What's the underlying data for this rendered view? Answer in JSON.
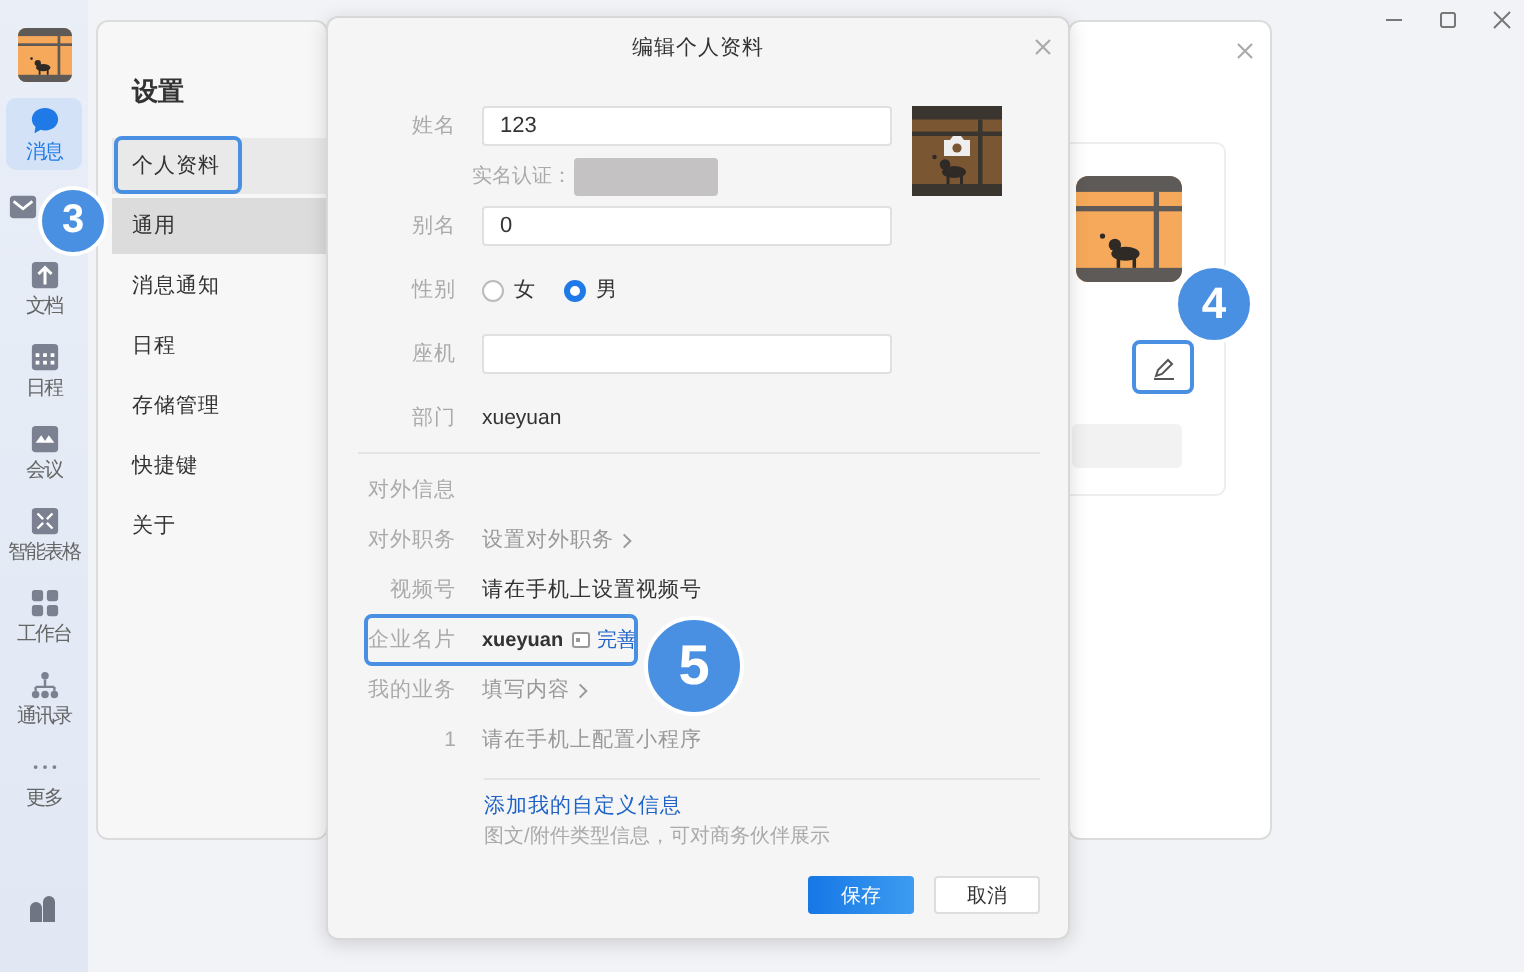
{
  "nav": {
    "items": [
      {
        "label": "消息",
        "selected": true
      },
      {
        "selected": false
      },
      {
        "label": "文档",
        "selected": false
      },
      {
        "label": "日程",
        "selected": false
      },
      {
        "label": "会议",
        "selected": false
      },
      {
        "label": "智能表格",
        "selected": false
      },
      {
        "label": "工作台",
        "selected": false
      },
      {
        "label": "通讯录",
        "selected": false
      },
      {
        "label": "更多",
        "selected": false
      }
    ]
  },
  "settings": {
    "title": "设置",
    "menu": [
      {
        "label": "个人资料",
        "selected": true,
        "hovered": false
      },
      {
        "label": "通用",
        "selected": false,
        "hovered": true
      },
      {
        "label": "消息通知",
        "selected": false,
        "hovered": false
      },
      {
        "label": "日程",
        "selected": false,
        "hovered": false
      },
      {
        "label": "存储管理",
        "selected": false,
        "hovered": false
      },
      {
        "label": "快捷键",
        "selected": false,
        "hovered": false
      },
      {
        "label": "关于",
        "selected": false,
        "hovered": false
      }
    ]
  },
  "dialog": {
    "title": "编辑个人资料",
    "rows": [
      {
        "kind": "input",
        "label": "姓名",
        "value": "123"
      },
      {
        "kind": "verify",
        "label": "实名认证："
      },
      {
        "kind": "input",
        "label": "别名",
        "value": "0"
      },
      {
        "kind": "radio",
        "label": "性别",
        "options": [
          {
            "label": "女",
            "selected": false
          },
          {
            "label": "男",
            "selected": true
          }
        ]
      },
      {
        "kind": "input",
        "label": "座机"
      },
      {
        "kind": "text",
        "label": "部门",
        "value": "xueyuan"
      },
      {
        "kind": "divider"
      },
      {
        "kind": "heading",
        "label": "对外信息"
      },
      {
        "kind": "action",
        "label": "对外职务",
        "value": "设置对外职务"
      },
      {
        "kind": "text",
        "label": "视频号",
        "value": "请在手机上设置视频号"
      },
      {
        "kind": "card",
        "label": "企业名片",
        "value": "xueyuan",
        "action": "完善"
      },
      {
        "kind": "action",
        "label": "我的业务",
        "value": "填写内容"
      },
      {
        "kind": "hint",
        "label": "1",
        "value": "请在手机上配置小程序"
      },
      {
        "kind": "divider"
      },
      {
        "kind": "custom",
        "value": "添加我的自定义信息",
        "hint": "图文/附件类型信息，可对商务伙伴展示"
      }
    ],
    "buttons": [
      {
        "label": "保存",
        "kind": "primary"
      },
      {
        "label": "取消",
        "kind": "secondary"
      }
    ]
  },
  "annotations": [
    {
      "label": "3"
    },
    {
      "label": "4"
    },
    {
      "label": "5"
    }
  ]
}
